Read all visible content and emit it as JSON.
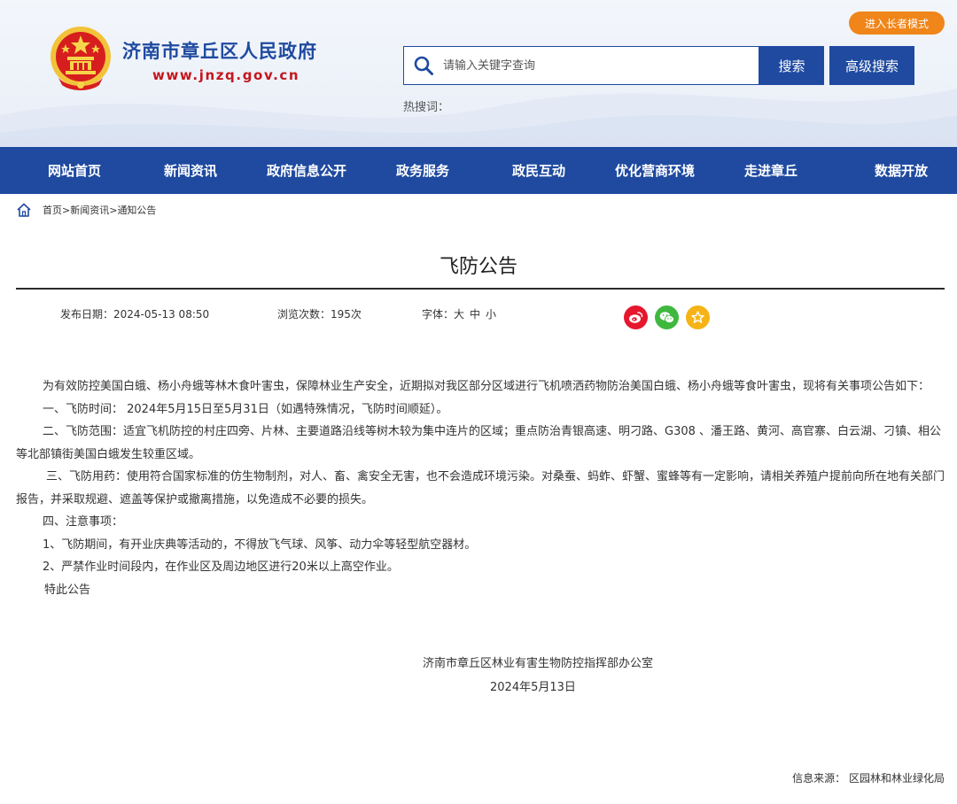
{
  "header": {
    "site_name": "济南市章丘区人民政府",
    "site_url": "www.jnzq.gov.cn",
    "elder_mode": "进入长者模式",
    "search": {
      "placeholder": "请输入关键字查询",
      "button": "搜索",
      "advanced_button": "高级搜索"
    },
    "hot_words_label": "热搜词："
  },
  "nav": {
    "items": [
      "网站首页",
      "新闻资讯",
      "政府信息公开",
      "政务服务",
      "政民互动",
      "优化营商环境",
      "走进章丘",
      "数据开放"
    ]
  },
  "breadcrumb": {
    "home": "首页",
    "sep1": ">",
    "level1": "新闻资讯",
    "sep2": ">",
    "level2": "通知公告"
  },
  "article": {
    "title": "飞防公告",
    "meta": {
      "date": "发布日期：2024-05-13 08:50",
      "views": "浏览次数：195次",
      "font_label": "字体：",
      "font_large": "大",
      "font_medium": "中",
      "font_small": "小"
    },
    "share_icons": [
      "weibo-icon",
      "wechat-icon",
      "favorite-icon"
    ],
    "paragraphs": [
      "为有效防控美国白蛾、杨小舟蛾等林木食叶害虫，保障林业生产安全，近期拟对我区部分区域进行飞机喷洒药物防治美国白蛾、杨小舟蛾等食叶害虫，现将有关事项公告如下：",
      "一、飞防时间： 2024年5月15日至5月31日（如遇特殊情况，飞防时间顺延）。",
      "二、飞防范围：适宜飞机防控的村庄四旁、片林、主要道路沿线等树木较为集中连片的区域；重点防治青银高速、明刁路、G308 、潘王路、黄河、高官寨、白云湖、刁镇、相公等北部镇街美国白蛾发生较重区域。",
      "三、飞防用药：使用符合国家标准的仿生物制剂，对人、畜、禽安全无害，也不会造成环境污染。对桑蚕、蚂蚱、虾蟹、蜜蜂等有一定影响，请相关养殖户提前向所在地有关部门报告，并采取规避、遮盖等保护或撤离措施，以免造成不必要的损失。",
      "四、注意事项：",
      "1、飞防期间，有开业庆典等活动的，不得放飞气球、风筝、动力伞等轻型航空器材。",
      "2、严禁作业时间段内，在作业区及周边地区进行20米以上高空作业。",
      "特此公告"
    ],
    "signature_org": "济南市章丘区林业有害生物防控指挥部办公室",
    "signature_date": "2024年5月13日",
    "source": "信息来源： 区园林和林业绿化局"
  },
  "colors": {
    "brand_blue": "#1f4aa0",
    "accent_orange": "#f08519",
    "url_red": "#c4161c",
    "weibo_red": "#e6162d",
    "wechat_green": "#3fb83f",
    "favorite_yellow": "#f5b316"
  }
}
